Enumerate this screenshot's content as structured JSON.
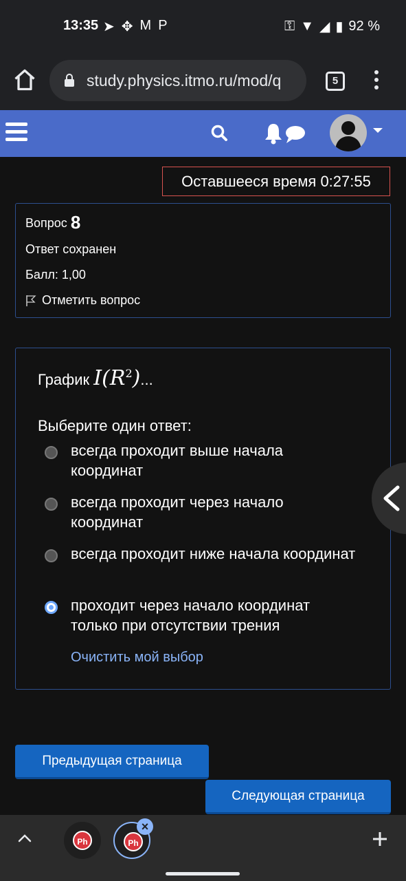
{
  "status_bar": {
    "time": "13:35",
    "battery": "92 %"
  },
  "browser": {
    "url": "study.physics.itmo.ru/mod/q",
    "tab_count": "5"
  },
  "timer": {
    "label": "Оставшееся время 0:27:55"
  },
  "question_info": {
    "label": "Вопрос",
    "number": "8",
    "state": "Ответ сохранен",
    "grade": "Балл: 1,00",
    "flag": "Отметить вопрос"
  },
  "question": {
    "prefix": "График",
    "suffix": "...",
    "prompt": "Выберите один ответ:",
    "options": [
      {
        "label": "всегда проходит выше начала координат",
        "selected": false
      },
      {
        "label": "всегда проходит через начало координат",
        "selected": false
      },
      {
        "label": "всегда проходит ниже начала координат",
        "selected": false
      },
      {
        "label": "проходит через начало координат только при отсутствии трения",
        "selected": true
      }
    ],
    "clear": "Очистить мой выбор"
  },
  "nav": {
    "prev": "Предыдущая страница",
    "next": "Следующая страница"
  },
  "tabs_bar": {
    "tab1": "Ph",
    "tab2": "Ph"
  },
  "colors": {
    "navbar": "#4a6bc9",
    "button": "#1565c0",
    "link": "#8ab4f8",
    "timer_border": "#d9534f"
  }
}
